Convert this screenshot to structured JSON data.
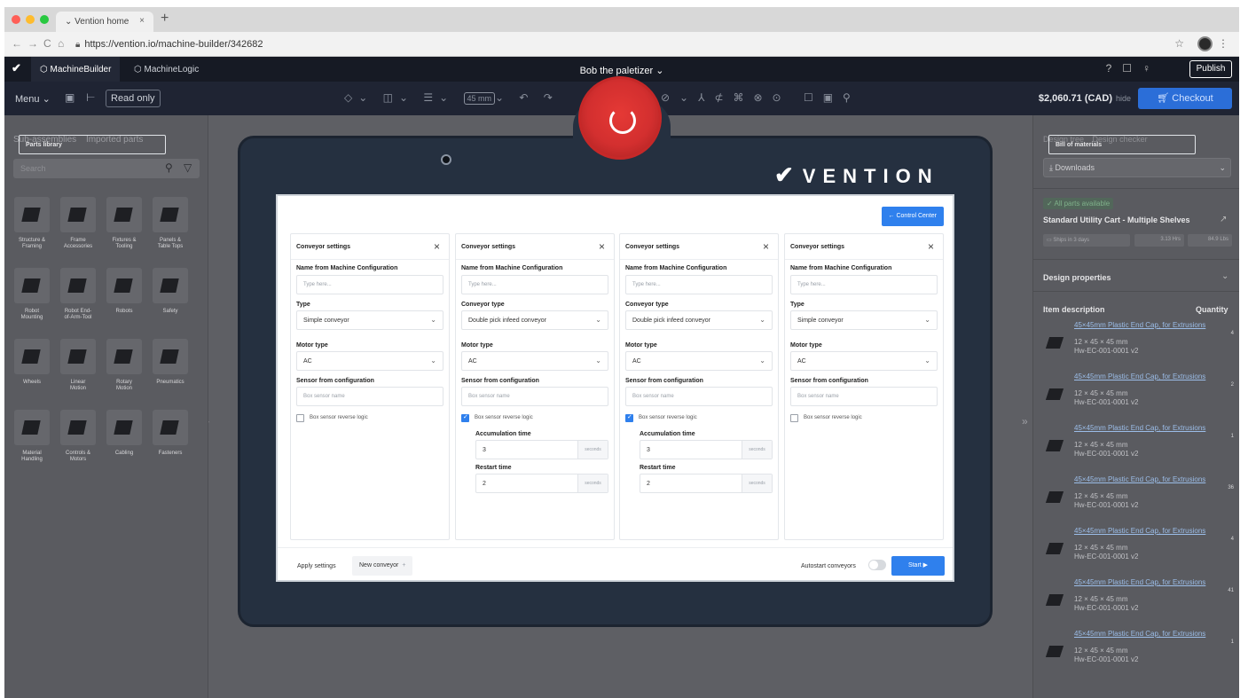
{
  "browser": {
    "tab_title": "Vention home",
    "url": "https://vention.io/machine-builder/342682"
  },
  "app_header": {
    "tabs": [
      "MachineBuilder",
      "MachineLogic"
    ],
    "project_name": "Bob the paletizer",
    "publish_label": "Publish"
  },
  "toolbar": {
    "menu_label": "Menu",
    "read_only_label": "Read only",
    "unit_value": "45 mm",
    "price": "$2,060.71 (CAD)",
    "hide_label": "hide",
    "checkout_label": "Checkout"
  },
  "left_panel": {
    "tabs": [
      "Parts library",
      "Sub-assemblies",
      "Imported parts"
    ],
    "search_placeholder": "Search",
    "categories": [
      [
        "Structure &",
        "Framing"
      ],
      [
        "Frame",
        "Accessories"
      ],
      [
        "Fixtures &",
        "Tooling"
      ],
      [
        "Panels &",
        "Table Tops"
      ],
      [
        "Robot",
        "Mounting"
      ],
      [
        "Robot End-",
        "of-Arm-Tool"
      ],
      [
        "Robots",
        ""
      ],
      [
        "Safety",
        ""
      ],
      [
        "Wheels",
        ""
      ],
      [
        "Linear",
        "Motion"
      ],
      [
        "Rotary",
        "Motion"
      ],
      [
        "Pneumatics",
        ""
      ],
      [
        "Material",
        "Handling"
      ],
      [
        "Controls &",
        "Motors"
      ],
      [
        "Cabling",
        ""
      ],
      [
        "Fasteners",
        ""
      ]
    ]
  },
  "right_panel": {
    "tabs": [
      "Bill of materials",
      "Design tree",
      "Design checker"
    ],
    "downloads_label": "Downloads",
    "availability": "All parts available",
    "cart_name": "Standard Utility Cart - Multiple Shelves",
    "stats": [
      "Ships in 3 days",
      "3.13 Hrs",
      "84.9 Lbs"
    ],
    "design_properties_label": "Design properties",
    "item_description_label": "Item description",
    "quantity_label": "Quantity",
    "items": [
      {
        "name": "45×45mm Plastic End Cap, for Extrusions",
        "dims": "12 × 45 × 45 mm",
        "code": "Hw-EC-001-0001 v2",
        "qty": "4"
      },
      {
        "name": "45×45mm Plastic End Cap, for Extrusions",
        "dims": "12 × 45 × 45 mm",
        "code": "Hw-EC-001-0001 v2",
        "qty": "2"
      },
      {
        "name": "45×45mm Plastic End Cap, for Extrusions",
        "dims": "12 × 45 × 45 mm",
        "code": "Hw-EC-001-0001 v2",
        "qty": "1"
      },
      {
        "name": "45×45mm Plastic End Cap, for Extrusions",
        "dims": "12 × 45 × 45 mm",
        "code": "Hw-EC-001-0001 v2",
        "qty": "36"
      },
      {
        "name": "45×45mm Plastic End Cap, for Extrusions",
        "dims": "12 × 45 × 45 mm",
        "code": "Hw-EC-001-0001 v2",
        "qty": "4"
      },
      {
        "name": "45×45mm Plastic End Cap, for Extrusions",
        "dims": "12 × 45 × 45 mm",
        "code": "Hw-EC-001-0001 v2",
        "qty": "41"
      },
      {
        "name": "45×45mm Plastic End Cap, for Extrusions",
        "dims": "12 × 45 × 45 mm",
        "code": "Hw-EC-001-0001 v2",
        "qty": "1"
      }
    ]
  },
  "device": {
    "brand": "VENTION"
  },
  "hmi": {
    "control_center_label": "← Control Center",
    "card_title": "Conveyor settings",
    "name_label": "Name from Machine Configuration",
    "name_placeholder": "Type here...",
    "motor_type_label": "Motor type",
    "sensor_label": "Sensor from configuration",
    "sensor_placeholder": "Box sensor name",
    "reverse_logic_label": "Box sensor reverse logic",
    "accumulation_label": "Accumulation time",
    "restart_label": "Restart time",
    "seconds_label": "seconds",
    "cards": [
      {
        "type_label": "Type",
        "type_value": "Simple conveyor",
        "motor_value": "AC",
        "reverse_checked": false
      },
      {
        "type_label": "Conveyor type",
        "type_value": "Double pick infeed conveyor",
        "motor_value": "AC",
        "reverse_checked": true,
        "accumulation": "3",
        "restart": "2"
      },
      {
        "type_label": "Conveyor type",
        "type_value": "Double pick infeed conveyor",
        "motor_value": "AC",
        "reverse_checked": true,
        "accumulation": "3",
        "restart": "2"
      },
      {
        "type_label": "Type",
        "type_value": "Simple conveyor",
        "motor_value": "AC",
        "reverse_checked": false
      }
    ],
    "apply_label": "Apply settings",
    "new_conveyor_label": "New conveyor",
    "autostart_label": "Autostart conveyors",
    "start_label": "Start ▶"
  },
  "colors": {
    "accent": "#2f80ed",
    "checkout": "#2b6ed8",
    "estop": "#d32f2f",
    "device_frame": "#253040"
  }
}
